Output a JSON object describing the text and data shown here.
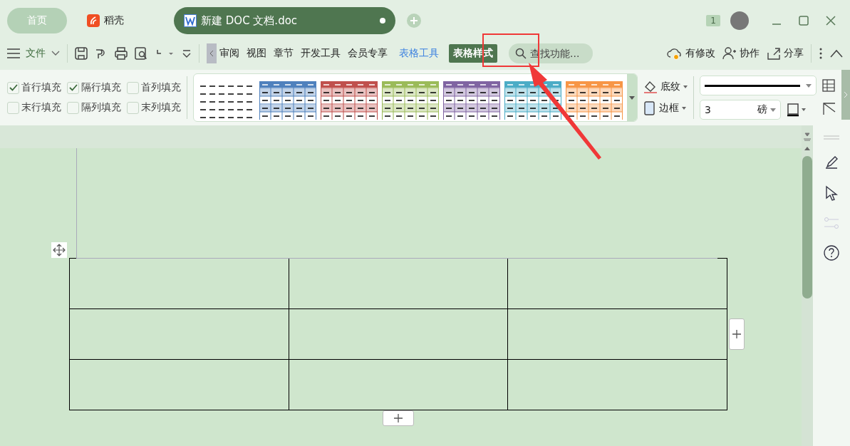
{
  "title_bar": {
    "tabs": [
      {
        "label": "首页",
        "kind": "home",
        "selected": false
      },
      {
        "label": "稻壳",
        "kind": "app",
        "selected": false
      },
      {
        "label": "新建 DOC 文档.doc",
        "kind": "doc",
        "selected": true
      }
    ],
    "badge": "1"
  },
  "toolbar": {
    "file_menu": "文件",
    "tabs": [
      {
        "label": "审阅",
        "kind": "normal",
        "selected": false
      },
      {
        "label": "视图",
        "kind": "normal",
        "selected": false
      },
      {
        "label": "章节",
        "kind": "normal",
        "selected": false
      },
      {
        "label": "开发工具",
        "kind": "normal",
        "selected": false
      },
      {
        "label": "会员专享",
        "kind": "normal",
        "selected": false
      },
      {
        "label": "表格工具",
        "kind": "context",
        "selected": false
      },
      {
        "label": "表格样式",
        "kind": "context",
        "selected": true
      }
    ],
    "search": {
      "placeholder": "查找功能..."
    },
    "actions": [
      "有修改",
      "协作",
      "分享"
    ]
  },
  "ribbon": {
    "options": [
      {
        "label": "首行填充",
        "checked": true
      },
      {
        "label": "隔行填充",
        "checked": true
      },
      {
        "label": "首列填充",
        "checked": false
      },
      {
        "label": "末行填充",
        "checked": false
      },
      {
        "label": "隔列填充",
        "checked": false
      },
      {
        "label": "末列填充",
        "checked": false
      }
    ],
    "styles": [
      {
        "kind": "plain"
      },
      {
        "kind": "colored",
        "color": "#4f81bd"
      },
      {
        "kind": "colored",
        "color": "#c0504d"
      },
      {
        "kind": "colored",
        "color": "#9bbb59"
      },
      {
        "kind": "colored",
        "color": "#8064a2"
      },
      {
        "kind": "colored",
        "color": "#4bacc6"
      },
      {
        "kind": "colored",
        "color": "#f79646"
      }
    ],
    "shading": "底纹",
    "border": "边框",
    "line_weight": "3",
    "unit": "磅"
  }
}
